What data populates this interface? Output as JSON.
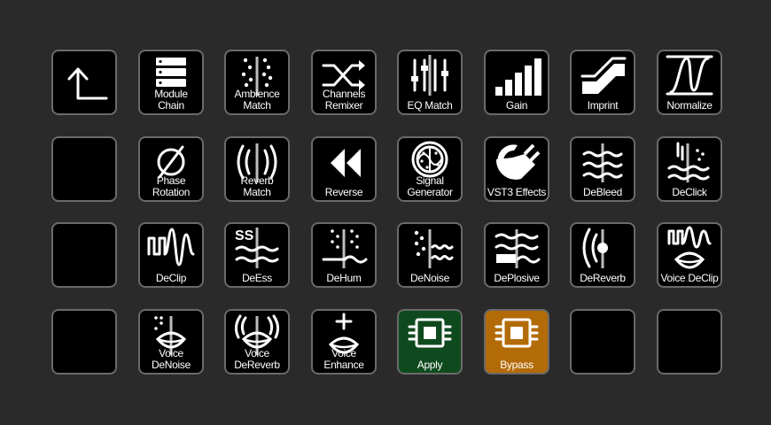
{
  "colors": {
    "background": "#2a2a2a",
    "key": "#000000",
    "border": "#6a6a6a",
    "apply": "#0f4a1e",
    "bypass": "#b36b08",
    "label": "#ffffff"
  },
  "keys": [
    {
      "label": "",
      "icon": "back-arrow-icon"
    },
    {
      "label": "Module\nChain",
      "icon": "module-chain-icon"
    },
    {
      "label": "Ambience\nMatch",
      "icon": "ambience-match-icon"
    },
    {
      "label": "Channels\nRemixer",
      "icon": "shuffle-icon"
    },
    {
      "label": "EQ Match",
      "icon": "eq-sliders-icon"
    },
    {
      "label": "Gain",
      "icon": "gain-bars-icon"
    },
    {
      "label": "Imprint",
      "icon": "imprint-icon"
    },
    {
      "label": "Normalize",
      "icon": "normalize-icon"
    },
    {
      "label": "",
      "icon": ""
    },
    {
      "label": "Phase Rotation",
      "icon": "phase-icon"
    },
    {
      "label": "Reverb Match",
      "icon": "reverb-match-icon"
    },
    {
      "label": "Reverse",
      "icon": "reverse-icon"
    },
    {
      "label": "Signal\nGenerator",
      "icon": "signal-generator-icon"
    },
    {
      "label": "VST3 Effects",
      "icon": "plug-icon"
    },
    {
      "label": "DeBleed",
      "icon": "debleed-icon"
    },
    {
      "label": "DeClick",
      "icon": "declick-icon"
    },
    {
      "label": "",
      "icon": ""
    },
    {
      "label": "DeClip",
      "icon": "declip-icon"
    },
    {
      "label": "DeEss",
      "icon": "deess-icon"
    },
    {
      "label": "DeHum",
      "icon": "dehum-icon"
    },
    {
      "label": "DeNoise",
      "icon": "denoise-icon"
    },
    {
      "label": "DePlosive",
      "icon": "deplosive-icon"
    },
    {
      "label": "DeReverb",
      "icon": "dereverb-icon"
    },
    {
      "label": "Voice DeClip",
      "icon": "voice-declip-icon"
    },
    {
      "label": "",
      "icon": ""
    },
    {
      "label": "Voice DeNoise",
      "icon": "voice-denoise-icon"
    },
    {
      "label": "Voice DeReverb",
      "icon": "voice-dereverb-icon"
    },
    {
      "label": "Voice Enhance",
      "icon": "voice-enhance-icon"
    },
    {
      "label": "Apply",
      "icon": "chip-icon",
      "color": "apply"
    },
    {
      "label": "Bypass",
      "icon": "chip-icon",
      "color": "bypass"
    },
    {
      "label": "",
      "icon": ""
    },
    {
      "label": "",
      "icon": ""
    }
  ]
}
